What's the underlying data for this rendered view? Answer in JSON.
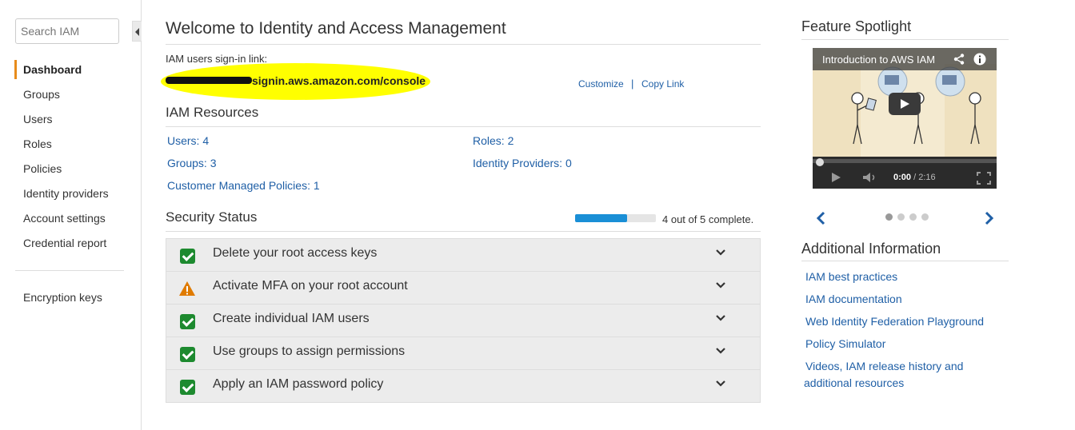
{
  "sidebar": {
    "search_placeholder": "Search IAM",
    "items": [
      {
        "label": "Dashboard",
        "active": true
      },
      {
        "label": "Groups"
      },
      {
        "label": "Users"
      },
      {
        "label": "Roles"
      },
      {
        "label": "Policies"
      },
      {
        "label": "Identity providers"
      },
      {
        "label": "Account settings"
      },
      {
        "label": "Credential report"
      }
    ],
    "extra_items": [
      {
        "label": "Encryption keys"
      }
    ]
  },
  "main": {
    "title": "Welcome to Identity and Access Management",
    "signin_label": "IAM users sign-in link:",
    "signin_link_visible": "signin.aws.amazon.com/console",
    "customize_label": "Customize",
    "separator": "|",
    "copy_link_label": "Copy Link",
    "resources_title": "IAM Resources",
    "resources": {
      "users": "Users: 4",
      "roles": "Roles: 2",
      "groups": "Groups: 3",
      "identity_providers": "Identity Providers: 0",
      "customer_managed_policies": "Customer Managed Policies: 1"
    },
    "security_title": "Security Status",
    "progress": {
      "completed": 4,
      "total": 5,
      "text": "4 out of 5 complete."
    },
    "security_items": [
      {
        "label": "Delete your root access keys",
        "status": "complete"
      },
      {
        "label": "Activate MFA on your root account",
        "status": "warning"
      },
      {
        "label": "Create individual IAM users",
        "status": "complete"
      },
      {
        "label": "Use groups to assign permissions",
        "status": "complete"
      },
      {
        "label": "Apply an IAM password policy",
        "status": "complete"
      }
    ]
  },
  "right": {
    "spotlight_title": "Feature Spotlight",
    "video": {
      "title": "Introduction to AWS IAM",
      "current_time": "0:00",
      "duration": "/ 2:16"
    },
    "carousel": {
      "pages": 4,
      "active": 0
    },
    "additional_title": "Additional Information",
    "links": [
      "IAM best practices",
      "IAM documentation",
      "Web Identity Federation Playground",
      "Policy Simulator",
      "Videos, IAM release history and",
      "additional resources"
    ]
  },
  "colors": {
    "accent": "#e88c1b",
    "link": "#1f5fa6",
    "check": "#1d8a2f",
    "warning": "#e07b00",
    "progress": "#1a8fd6",
    "highlight": "#ffff00"
  }
}
